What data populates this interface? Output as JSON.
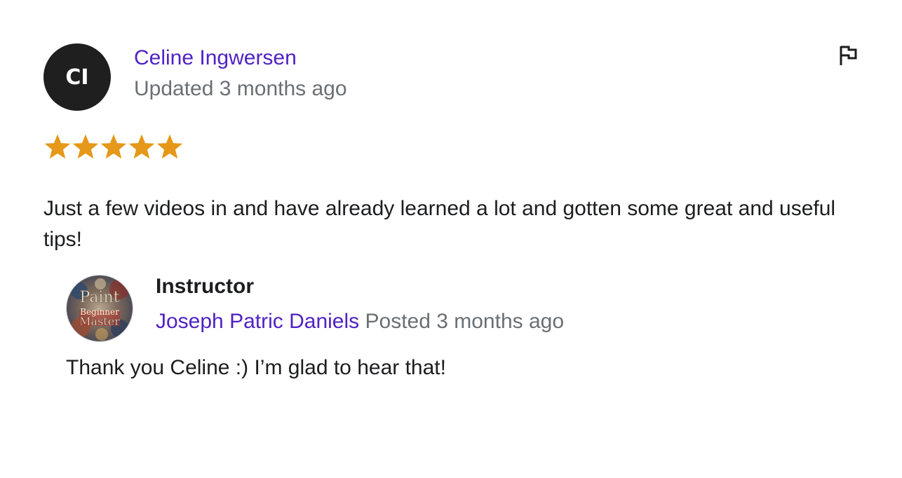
{
  "review": {
    "reviewer_initials": "CI",
    "reviewer_name": "Celine Ingwersen",
    "updated_text": "Updated 3 months ago",
    "rating": 5,
    "rating_max": 5,
    "star_color": "#e59819",
    "comment": "Just a few videos in and have already learned a lot and gotten some great and useful tips!",
    "report_icon": "flag-icon"
  },
  "instructor_response": {
    "role_label": "Instructor",
    "name": "Joseph Patric Daniels",
    "posted_text": "Posted 3 months ago",
    "avatar_logo_text": [
      "Paint",
      "Beginner",
      "Master"
    ],
    "reply": "Thank you Celine :) I’m glad to hear that!"
  },
  "colors": {
    "link_purple": "#5022c3",
    "muted_gray": "#6a6f73",
    "text_dark": "#1c1d1f",
    "avatar_bg": "#1f1f1f"
  }
}
